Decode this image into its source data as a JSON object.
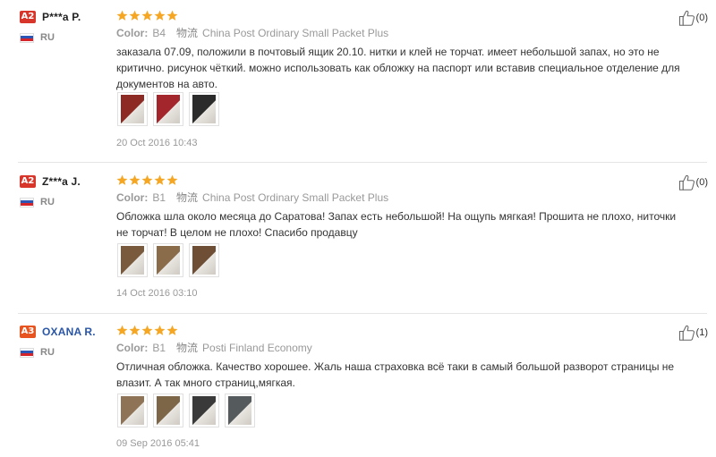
{
  "labels": {
    "color": "Color:",
    "shipping_glyph": "物流"
  },
  "reviews": [
    {
      "level": "A2",
      "level_color": "#d9362b",
      "user": "P***a P.",
      "user_link": false,
      "country": "RU",
      "rating": 5,
      "color_value": "B4",
      "shipping": "China Post Ordinary Small Packet Plus",
      "text": "заказала 07.09, положили в почтовый ящик 20.10. нитки и клей не торчат. имеет небольшой запах, но это не критично. рисунок чёткий. можно использовать как обложку на паспорт или вставив специальное отделение для документов на авто.",
      "photos": [
        "#8c2a23",
        "#a3262c",
        "#2b2b2b"
      ],
      "date": "20 Oct 2016 10:43",
      "helpful": "(0)"
    },
    {
      "level": "A2",
      "level_color": "#d9362b",
      "user": "Z***a J.",
      "user_link": false,
      "country": "RU",
      "rating": 5,
      "color_value": "B1",
      "shipping": "China Post Ordinary Small Packet Plus",
      "text": "Обложка шла около месяца до Саратова! Запах есть небольшой! На ощупь мягкая! Прошита не плохо, ниточки не торчат! В целом не плохо! Спасибо продавцу",
      "photos": [
        "#7a5a3c",
        "#8a6b4a",
        "#6e4f36"
      ],
      "date": "14 Oct 2016 03:10",
      "helpful": "(0)"
    },
    {
      "level": "A3",
      "level_color": "#e7541f",
      "user": "OXANA R.",
      "user_link": true,
      "country": "RU",
      "rating": 5,
      "color_value": "B1",
      "shipping": "Posti Finland Economy",
      "text": "Отличная обложка. Качество хорошее. Жаль наша страховка всё таки в самый большой разворот страницы не влазит. А так много страниц,мягкая.",
      "photos": [
        "#8f7356",
        "#7d6648",
        "#3a3a3a",
        "#555a5c"
      ],
      "date": "09 Sep 2016 05:41",
      "helpful": "(1)"
    }
  ]
}
